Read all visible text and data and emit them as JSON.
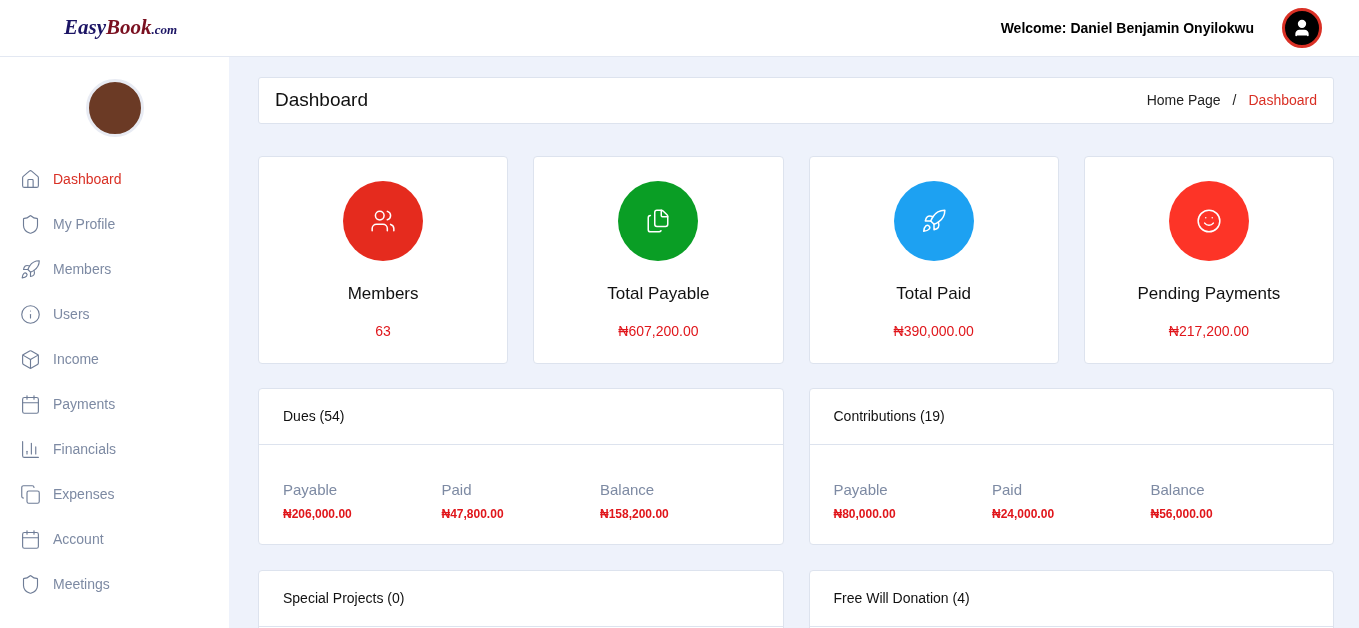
{
  "header": {
    "logo": [
      {
        "text": "Easy",
        "color": "#1b1464"
      },
      {
        "text": "Book",
        "color": "#7a1020"
      },
      {
        "text": ".com",
        "color": "#1b1464"
      }
    ],
    "welcome": "Welcome: Daniel Benjamin Onyilokwu"
  },
  "sidebar": {
    "items": [
      {
        "label": "Dashboard",
        "selected": true
      },
      {
        "label": "My Profile",
        "selected": false
      },
      {
        "label": "Members",
        "selected": false
      },
      {
        "label": "Users",
        "selected": false
      },
      {
        "label": "Income",
        "selected": false
      },
      {
        "label": "Payments",
        "selected": false
      },
      {
        "label": "Financials",
        "selected": false
      },
      {
        "label": "Expenses",
        "selected": false
      },
      {
        "label": "Account",
        "selected": false
      },
      {
        "label": "Meetings",
        "selected": false
      }
    ]
  },
  "page_header": {
    "title": "Dashboard",
    "breadcrumb": [
      {
        "label": "Home Page",
        "selected": false
      },
      {
        "label": "Dashboard",
        "selected": true
      }
    ],
    "separator": "/"
  },
  "stats": [
    {
      "title": "Members",
      "value": "63",
      "color": "#e52b1e"
    },
    {
      "title": "Total Payable",
      "value": "₦607,200.00",
      "color": "#0a9e25"
    },
    {
      "title": "Total Paid",
      "value": "₦390,000.00",
      "color": "#1da1f2"
    },
    {
      "title": "Pending Payments",
      "value": "₦217,200.00",
      "color": "#fd3427"
    }
  ],
  "summaries": [
    {
      "title": "Dues (54)",
      "fields": [
        {
          "label": "Payable",
          "value": "₦206,000.00"
        },
        {
          "label": "Paid",
          "value": "₦47,800.00"
        },
        {
          "label": "Balance",
          "value": "₦158,200.00"
        }
      ]
    },
    {
      "title": "Contributions (19)",
      "fields": [
        {
          "label": "Payable",
          "value": "₦80,000.00"
        },
        {
          "label": "Paid",
          "value": "₦24,000.00"
        },
        {
          "label": "Balance",
          "value": "₦56,000.00"
        }
      ]
    },
    {
      "title": "Special Projects (0)"
    },
    {
      "title": "Free Will Donation (4)"
    }
  ]
}
